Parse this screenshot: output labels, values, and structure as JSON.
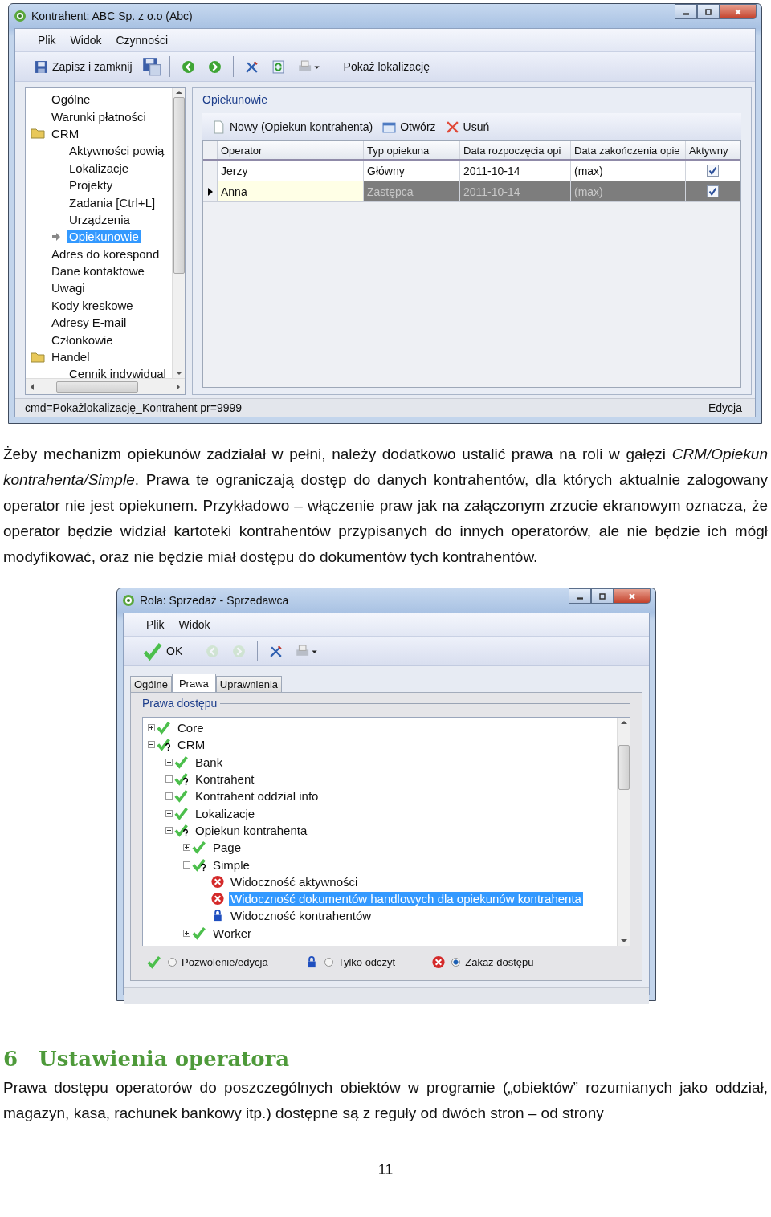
{
  "window1": {
    "title": "Kontrahent: ABC Sp. z o.o (Abc)",
    "menu": [
      "Plik",
      "Widok",
      "Czynności"
    ],
    "toolbar": [
      {
        "kind": "save",
        "label": "Zapisz i zamknij"
      },
      {
        "kind": "save-as"
      },
      {
        "kind": "separator"
      },
      {
        "kind": "back",
        "disabled": false
      },
      {
        "kind": "forward",
        "disabled": false
      },
      {
        "kind": "separator"
      },
      {
        "kind": "tools"
      },
      {
        "kind": "refresh"
      },
      {
        "kind": "print"
      },
      {
        "kind": "separator"
      },
      {
        "kind": "link",
        "label": "Pokaż lokalizację"
      }
    ],
    "nav": [
      {
        "label": "Ogólne",
        "selected": false
      },
      {
        "label": "Warunki płatności",
        "selected": false
      },
      {
        "label": "CRM",
        "kind": "folder",
        "selected": false,
        "children": [
          {
            "label": "Aktywności powią",
            "selected": false
          },
          {
            "label": "Lokalizacje",
            "selected": false
          },
          {
            "label": "Projekty",
            "selected": false
          },
          {
            "label": "Zadania [Ctrl+L]",
            "selected": false
          },
          {
            "label": "Urządzenia",
            "selected": false
          },
          {
            "label": "Opiekunowie",
            "selected": true
          }
        ]
      },
      {
        "label": "Adres do korespond",
        "selected": false
      },
      {
        "label": "Dane kontaktowe",
        "selected": false
      },
      {
        "label": "Uwagi",
        "selected": false
      },
      {
        "label": "Kody kreskowe",
        "selected": false
      },
      {
        "label": "Adresy E-mail",
        "selected": false
      },
      {
        "label": "Członkowie",
        "selected": false
      },
      {
        "label": "Handel",
        "kind": "folder",
        "selected": false,
        "children": [
          {
            "label": "Cennik indywidual",
            "selected": false
          }
        ]
      }
    ],
    "section_title": "Opiekunowie",
    "grid_toolbar": [
      {
        "kind": "new",
        "label": "Nowy (Opiekun kontrahenta)"
      },
      {
        "kind": "open",
        "label": "Otwórz"
      },
      {
        "kind": "delete",
        "label": "Usuń"
      }
    ],
    "table": {
      "columns": [
        "Operator",
        "Typ opiekuna",
        "Data rozpoczęcia opi",
        "Data zakończenia opie",
        "Aktywny"
      ],
      "rows": [
        {
          "cells": [
            "Jerzy",
            "Główny",
            "2011-10-14",
            "(max)"
          ],
          "active": true,
          "selected": false
        },
        {
          "cells": [
            "Anna",
            "Zastępca",
            "2011-10-14",
            "(max)"
          ],
          "active": true,
          "selected": true
        }
      ]
    },
    "status_bar": {
      "command": "cmd=Pokażlokalizację_Kontrahent pr=9999",
      "mode": "Edycja"
    }
  },
  "paragraph_1": "Żeby mechanizm opiekunów zadziałał w pełni, należy dodatkowo ustalić prawa na roli w gałęzi *CRM/Opiekun kontrahenta/Simple*. Prawa te ograniczają dostęp do danych kontrahentów, dla których aktualnie zalogowany operator nie jest opiekunem. Przykładowo – włączenie praw jak na załączonym zrzucie ekranowym oznacza, że operator będzie widział kartoteki kontrahentów przypisanych do innych operatorów, ale nie będzie ich mógł modyfikować, oraz nie będzie miał dostępu do dokumentów tych kontrahentów.",
  "window2": {
    "title": "Rola: Sprzedaż - Sprzedawca",
    "menu": [
      "Plik",
      "Widok"
    ],
    "toolbar": [
      {
        "kind": "ok",
        "label": "OK"
      },
      {
        "kind": "separator"
      },
      {
        "kind": "back",
        "disabled": true
      },
      {
        "kind": "forward",
        "disabled": true
      },
      {
        "kind": "separator"
      },
      {
        "kind": "tools"
      },
      {
        "kind": "print"
      }
    ],
    "tabs": [
      {
        "label": "Ogólne",
        "selected": false
      },
      {
        "label": "Prawa",
        "selected": true
      },
      {
        "label": "Uprawnienia",
        "selected": false
      }
    ],
    "group_title": "Prawa dostępu",
    "tree": [
      {
        "label": "Core",
        "kind": "allow",
        "expanded": false,
        "selected": false
      },
      {
        "label": "CRM",
        "kind": "partial",
        "expanded": true,
        "selected": false,
        "children": [
          {
            "label": "Bank",
            "kind": "allow",
            "expanded": false,
            "selected": false
          },
          {
            "label": "Kontrahent",
            "kind": "partial",
            "expanded": false,
            "selected": false
          },
          {
            "label": "Kontrahent oddzial info",
            "kind": "allow",
            "expanded": false,
            "selected": false
          },
          {
            "label": "Lokalizacje",
            "kind": "allow",
            "expanded": false,
            "selected": false
          },
          {
            "label": "Opiekun kontrahenta",
            "kind": "partial",
            "expanded": true,
            "selected": false,
            "children": [
              {
                "label": "Page",
                "kind": "allow",
                "expanded": false,
                "selected": false
              },
              {
                "label": "Simple",
                "kind": "partial",
                "expanded": true,
                "selected": false,
                "children": [
                  {
                    "label": "Widoczność aktywności",
                    "kind": "deny",
                    "selected": false
                  },
                  {
                    "label": "Widoczność dokumentów handlowych dla opiekunów kontrahenta",
                    "kind": "deny",
                    "selected": true
                  },
                  {
                    "label": "Widoczność kontrahentów",
                    "kind": "readonly",
                    "selected": false
                  }
                ]
              },
              {
                "label": "Worker",
                "kind": "allow",
                "expanded": false,
                "selected": false
              }
            ]
          }
        ]
      }
    ],
    "options": [
      {
        "kind": "allow",
        "label": "Pozwolenie/edycja",
        "selected": false
      },
      {
        "kind": "readonly",
        "label": "Tylko odczyt",
        "selected": false
      },
      {
        "kind": "deny",
        "label": "Zakaz dostępu",
        "selected": true
      }
    ]
  },
  "heading": {
    "number": "6",
    "title": "Ustawienia operatora"
  },
  "paragraph_2": "Prawa dostępu operatorów do poszczególnych obiektów w programie („obiektów” rozumianych jako oddział, magazyn, kasa, rachunek bankowy itp.) dostępne są z reguły od dwóch stron – od strony",
  "page_number": "11"
}
